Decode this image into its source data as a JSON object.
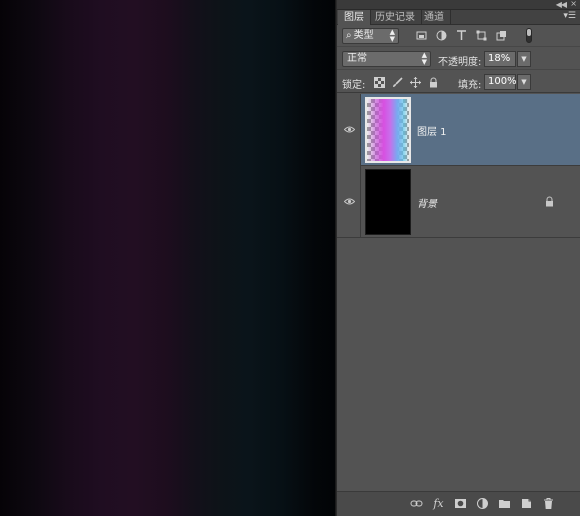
{
  "panel": {
    "tabs": [
      {
        "label": "图层",
        "active": true
      },
      {
        "label": "历史记录",
        "active": false
      },
      {
        "label": "通道",
        "active": false
      }
    ],
    "filter": {
      "kind_label": "类型"
    },
    "blend": {
      "mode": "正常",
      "opacity_label": "不透明度:",
      "opacity_value": "18%",
      "lock_label": "锁定:",
      "fill_label": "填充:",
      "fill_value": "100%"
    },
    "layers": [
      {
        "name": "图层 1",
        "visible": true,
        "selected": true,
        "locked": false
      },
      {
        "name": "背景",
        "visible": true,
        "selected": false,
        "locked": true
      }
    ]
  },
  "colors": {
    "canvas_gradient": [
      "#060307",
      "#220e22",
      "#0a141a",
      "#020406"
    ],
    "selected_row": "#596f86",
    "panel_bg": "#535353"
  },
  "icons": [
    "collapse-icon",
    "close-icon",
    "panel-menu-icon",
    "search-icon",
    "filter-pixel-icon",
    "filter-adjustment-icon",
    "filter-type-icon",
    "filter-shape-icon",
    "filter-smart-object-icon",
    "filter-toggle-switch",
    "lock-transparent-icon",
    "lock-paint-icon",
    "lock-move-icon",
    "lock-all-icon",
    "eye-icon",
    "lock-icon",
    "link-icon",
    "fx-icon",
    "mask-icon",
    "adjustment-layer-icon",
    "group-folder-icon",
    "new-layer-icon",
    "trash-icon"
  ]
}
